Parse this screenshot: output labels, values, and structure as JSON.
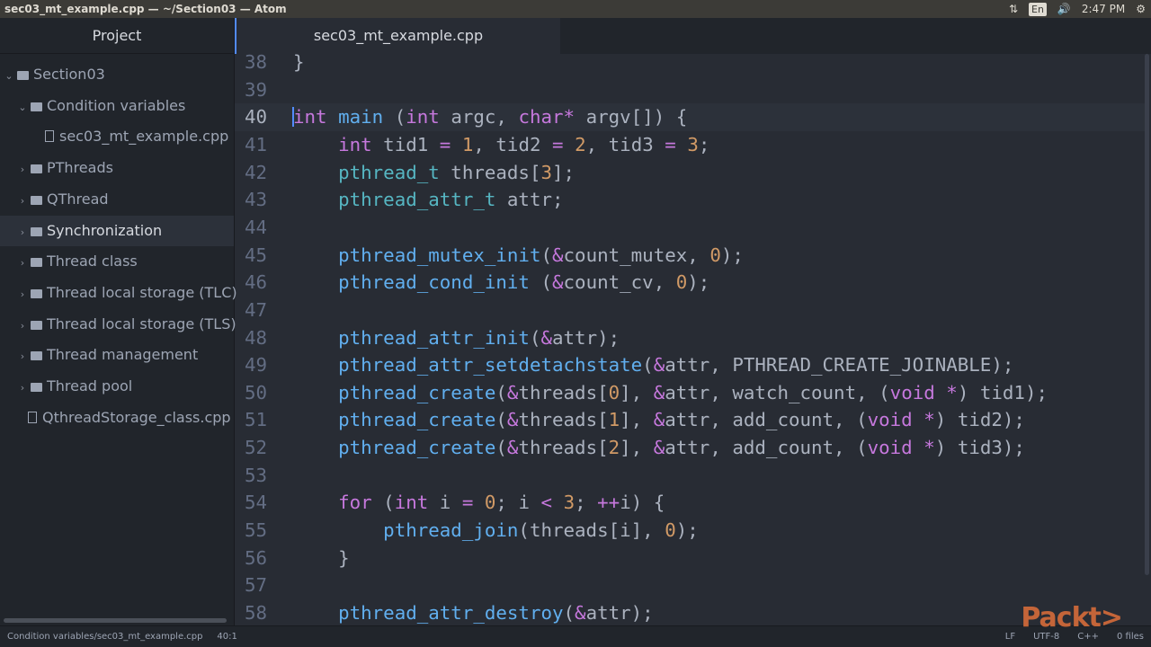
{
  "window": {
    "title": "sec03_mt_example.cpp — ~/Section03 — Atom"
  },
  "tray": {
    "network_icon": "⇅",
    "lang": "En",
    "volume_icon": "🔊",
    "time": "2:47 PM",
    "settings_icon": "⚙"
  },
  "sidebar": {
    "title": "Project",
    "items": [
      {
        "label": "Section03",
        "kind": "folder",
        "open": true,
        "depth": 0
      },
      {
        "label": "Condition variables",
        "kind": "folder",
        "open": true,
        "depth": 1
      },
      {
        "label": "sec03_mt_example.cpp",
        "kind": "file",
        "depth": 2
      },
      {
        "label": "PThreads",
        "kind": "folder",
        "open": false,
        "depth": 1
      },
      {
        "label": "QThread",
        "kind": "folder",
        "open": false,
        "depth": 1
      },
      {
        "label": "Synchronization",
        "kind": "folder",
        "open": false,
        "depth": 1,
        "selected": true
      },
      {
        "label": "Thread class",
        "kind": "folder",
        "open": false,
        "depth": 1
      },
      {
        "label": "Thread local storage (TLC)",
        "kind": "folder",
        "open": false,
        "depth": 1
      },
      {
        "label": "Thread local storage (TLS)",
        "kind": "folder",
        "open": false,
        "depth": 1
      },
      {
        "label": "Thread management",
        "kind": "folder",
        "open": false,
        "depth": 1
      },
      {
        "label": "Thread pool",
        "kind": "folder",
        "open": false,
        "depth": 1
      },
      {
        "label": "QthreadStorage_class.cpp",
        "kind": "file",
        "depth": 1
      }
    ]
  },
  "tab": {
    "label": "sec03_mt_example.cpp"
  },
  "editor": {
    "current_line": "40",
    "lines": [
      {
        "n": "38",
        "t": [
          [
            "p",
            "}"
          ]
        ]
      },
      {
        "n": "39",
        "t": []
      },
      {
        "n": "40",
        "t": [
          [
            "k",
            "int"
          ],
          [
            "p",
            " "
          ],
          [
            "f",
            "main"
          ],
          [
            "p",
            " ("
          ],
          [
            "k",
            "int"
          ],
          [
            "p",
            " argc, "
          ],
          [
            "k",
            "char"
          ],
          [
            "o",
            "*"
          ],
          [
            "p",
            " argv[]) {"
          ]
        ]
      },
      {
        "n": "41",
        "t": [
          [
            "p",
            "    "
          ],
          [
            "k",
            "int"
          ],
          [
            "p",
            " tid1 "
          ],
          [
            "o",
            "="
          ],
          [
            "p",
            " "
          ],
          [
            "n",
            "1"
          ],
          [
            "p",
            ", tid2 "
          ],
          [
            "o",
            "="
          ],
          [
            "p",
            " "
          ],
          [
            "n",
            "2"
          ],
          [
            "p",
            ", tid3 "
          ],
          [
            "o",
            "="
          ],
          [
            "p",
            " "
          ],
          [
            "n",
            "3"
          ],
          [
            "p",
            ";"
          ]
        ]
      },
      {
        "n": "42",
        "t": [
          [
            "p",
            "    "
          ],
          [
            "t",
            "pthread_t"
          ],
          [
            "p",
            " threads["
          ],
          [
            "n",
            "3"
          ],
          [
            "p",
            "];"
          ]
        ]
      },
      {
        "n": "43",
        "t": [
          [
            "p",
            "    "
          ],
          [
            "t",
            "pthread_attr_t"
          ],
          [
            "p",
            " attr;"
          ]
        ]
      },
      {
        "n": "44",
        "t": []
      },
      {
        "n": "45",
        "t": [
          [
            "p",
            "    "
          ],
          [
            "f",
            "pthread_mutex_init"
          ],
          [
            "p",
            "("
          ],
          [
            "o",
            "&"
          ],
          [
            "p",
            "count_mutex, "
          ],
          [
            "n",
            "0"
          ],
          [
            "p",
            ");"
          ]
        ]
      },
      {
        "n": "46",
        "t": [
          [
            "p",
            "    "
          ],
          [
            "f",
            "pthread_cond_init"
          ],
          [
            "p",
            " ("
          ],
          [
            "o",
            "&"
          ],
          [
            "p",
            "count_cv, "
          ],
          [
            "n",
            "0"
          ],
          [
            "p",
            ");"
          ]
        ]
      },
      {
        "n": "47",
        "t": []
      },
      {
        "n": "48",
        "t": [
          [
            "p",
            "    "
          ],
          [
            "f",
            "pthread_attr_init"
          ],
          [
            "p",
            "("
          ],
          [
            "o",
            "&"
          ],
          [
            "p",
            "attr);"
          ]
        ]
      },
      {
        "n": "49",
        "t": [
          [
            "p",
            "    "
          ],
          [
            "f",
            "pthread_attr_setdetachstate"
          ],
          [
            "p",
            "("
          ],
          [
            "o",
            "&"
          ],
          [
            "p",
            "attr, PTHREAD_CREATE_JOINABLE);"
          ]
        ]
      },
      {
        "n": "50",
        "t": [
          [
            "p",
            "    "
          ],
          [
            "f",
            "pthread_create"
          ],
          [
            "p",
            "("
          ],
          [
            "o",
            "&"
          ],
          [
            "p",
            "threads["
          ],
          [
            "n",
            "0"
          ],
          [
            "p",
            "], "
          ],
          [
            "o",
            "&"
          ],
          [
            "p",
            "attr, watch_count, ("
          ],
          [
            "k",
            "void"
          ],
          [
            "p",
            " "
          ],
          [
            "o",
            "*"
          ],
          [
            "p",
            ") tid1);"
          ]
        ]
      },
      {
        "n": "51",
        "t": [
          [
            "p",
            "    "
          ],
          [
            "f",
            "pthread_create"
          ],
          [
            "p",
            "("
          ],
          [
            "o",
            "&"
          ],
          [
            "p",
            "threads["
          ],
          [
            "n",
            "1"
          ],
          [
            "p",
            "], "
          ],
          [
            "o",
            "&"
          ],
          [
            "p",
            "attr, add_count, ("
          ],
          [
            "k",
            "void"
          ],
          [
            "p",
            " "
          ],
          [
            "o",
            "*"
          ],
          [
            "p",
            ") tid2);"
          ]
        ]
      },
      {
        "n": "52",
        "t": [
          [
            "p",
            "    "
          ],
          [
            "f",
            "pthread_create"
          ],
          [
            "p",
            "("
          ],
          [
            "o",
            "&"
          ],
          [
            "p",
            "threads["
          ],
          [
            "n",
            "2"
          ],
          [
            "p",
            "], "
          ],
          [
            "o",
            "&"
          ],
          [
            "p",
            "attr, add_count, ("
          ],
          [
            "k",
            "void"
          ],
          [
            "p",
            " "
          ],
          [
            "o",
            "*"
          ],
          [
            "p",
            ") tid3);"
          ]
        ]
      },
      {
        "n": "53",
        "t": []
      },
      {
        "n": "54",
        "t": [
          [
            "p",
            "    "
          ],
          [
            "k",
            "for"
          ],
          [
            "p",
            " ("
          ],
          [
            "k",
            "int"
          ],
          [
            "p",
            " i "
          ],
          [
            "o",
            "="
          ],
          [
            "p",
            " "
          ],
          [
            "n",
            "0"
          ],
          [
            "p",
            "; i "
          ],
          [
            "o",
            "<"
          ],
          [
            "p",
            " "
          ],
          [
            "n",
            "3"
          ],
          [
            "p",
            "; "
          ],
          [
            "o",
            "++"
          ],
          [
            "p",
            "i) {"
          ]
        ]
      },
      {
        "n": "55",
        "t": [
          [
            "p",
            "        "
          ],
          [
            "f",
            "pthread_join"
          ],
          [
            "p",
            "(threads[i], "
          ],
          [
            "n",
            "0"
          ],
          [
            "p",
            ");"
          ]
        ]
      },
      {
        "n": "56",
        "t": [
          [
            "p",
            "    }"
          ]
        ]
      },
      {
        "n": "57",
        "t": []
      },
      {
        "n": "58",
        "t": [
          [
            "p",
            "    "
          ],
          [
            "f",
            "pthread_attr_destroy"
          ],
          [
            "p",
            "("
          ],
          [
            "o",
            "&"
          ],
          [
            "p",
            "attr);"
          ]
        ]
      }
    ]
  },
  "status": {
    "path": "Condition variables/sec03_mt_example.cpp",
    "cursor": "40:1",
    "eol": "LF",
    "encoding": "UTF-8",
    "grammar": "C++",
    "files": "0 files"
  },
  "watermark": {
    "text": "Packt>"
  }
}
